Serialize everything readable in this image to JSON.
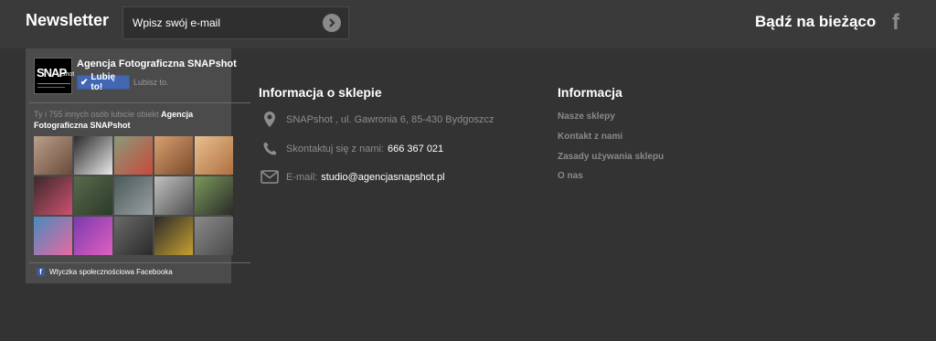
{
  "newsletter": {
    "title": "Newsletter",
    "placeholder": "Wpisz swój e-mail"
  },
  "social": {
    "title": "Bądź na bieżąco",
    "facebook_icon": "f"
  },
  "fb_widget": {
    "logo_text": "SNAP",
    "logo_suffix": "shot",
    "page_name": "Agencja Fotograficzna SNAPshot",
    "like_button": "Lubię to!",
    "like_text": "Lubisz to.",
    "count_prefix": "Ty i 755 innych osób lubicie obiekt ",
    "count_page": "Agencja Fotograficzna SNAPshot",
    "plugin_label": "Wtyczka społecznościowa Facebooka",
    "faces": [
      {
        "colors": [
          "#b8a08a",
          "#6b4a3a"
        ]
      },
      {
        "colors": [
          "#2b2b2b",
          "#e8e8e8"
        ]
      },
      {
        "colors": [
          "#8a9a7a",
          "#c84a3a"
        ]
      },
      {
        "colors": [
          "#d8a070",
          "#7a4a2a"
        ]
      },
      {
        "colors": [
          "#e8c090",
          "#b07040"
        ]
      },
      {
        "colors": [
          "#3a2a2a",
          "#d05070"
        ]
      },
      {
        "colors": [
          "#5a6a4a",
          "#2a3a2a"
        ]
      },
      {
        "colors": [
          "#4a5a5a",
          "#9aa0a0"
        ]
      },
      {
        "colors": [
          "#c0c0c0",
          "#505050"
        ]
      },
      {
        "colors": [
          "#7a9a5a",
          "#2a2a2a"
        ]
      },
      {
        "colors": [
          "#4a8ac0",
          "#e86aa0"
        ]
      },
      {
        "colors": [
          "#7a3ab0",
          "#e060c0"
        ]
      },
      {
        "colors": [
          "#6a6a6a",
          "#2a2a2a"
        ]
      },
      {
        "colors": [
          "#2a2a2a",
          "#c8a030"
        ]
      },
      {
        "colors": [
          "#8a8a8a",
          "#4a4a4a"
        ]
      },
      {
        "colors": [
          "#d8dde8",
          "#c0c6d2"
        ]
      }
    ]
  },
  "store_info": {
    "title": "Informacja o sklepie",
    "address": "SNAPshot , ul. Gawronia 6, 85-430 Bydgoszcz",
    "phone_label": "Skontaktuj się z nami:",
    "phone": "666 367 021",
    "email_label": "E-mail:",
    "email": "studio@agencjasnapshot.pl"
  },
  "info": {
    "title": "Informacja",
    "links": [
      "Nasze sklepy",
      "Kontakt z nami",
      "Zasady używania sklepu",
      "O nas"
    ]
  }
}
